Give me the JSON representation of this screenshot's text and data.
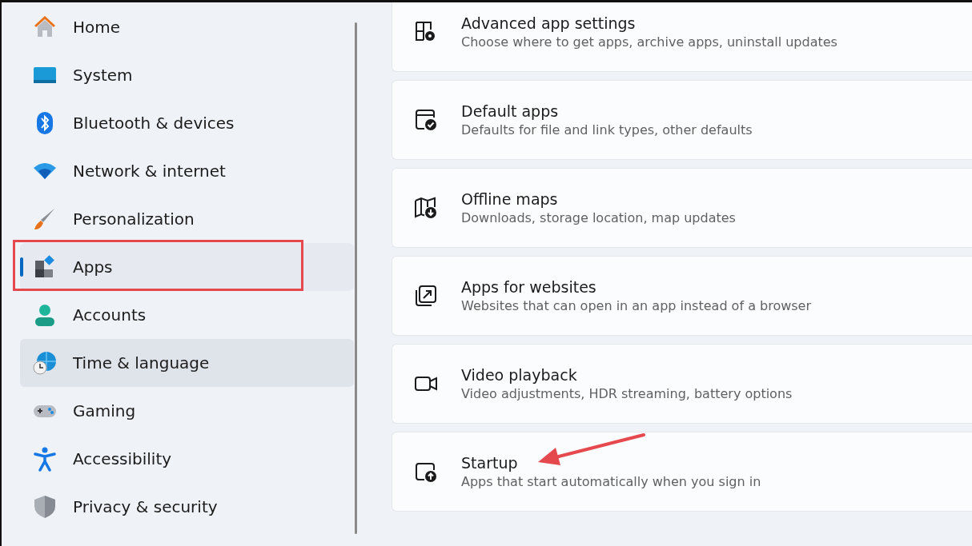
{
  "sidebar": {
    "items": [
      {
        "label": "Home",
        "selected": false,
        "hovered": false,
        "highlighted": false
      },
      {
        "label": "System",
        "selected": false,
        "hovered": false,
        "highlighted": false
      },
      {
        "label": "Bluetooth & devices",
        "selected": false,
        "hovered": false,
        "highlighted": false
      },
      {
        "label": "Network & internet",
        "selected": false,
        "hovered": false,
        "highlighted": false
      },
      {
        "label": "Personalization",
        "selected": false,
        "hovered": false,
        "highlighted": false
      },
      {
        "label": "Apps",
        "selected": true,
        "hovered": false,
        "highlighted": true
      },
      {
        "label": "Accounts",
        "selected": false,
        "hovered": false,
        "highlighted": false
      },
      {
        "label": "Time & language",
        "selected": false,
        "hovered": true,
        "highlighted": false
      },
      {
        "label": "Gaming",
        "selected": false,
        "hovered": false,
        "highlighted": false
      },
      {
        "label": "Accessibility",
        "selected": false,
        "hovered": false,
        "highlighted": false
      },
      {
        "label": "Privacy & security",
        "selected": false,
        "hovered": false,
        "highlighted": false
      }
    ]
  },
  "settings": [
    {
      "title": "Advanced app settings",
      "description": "Choose where to get apps, archive apps, uninstall updates",
      "pointed": false
    },
    {
      "title": "Default apps",
      "description": "Defaults for file and link types, other defaults",
      "pointed": false
    },
    {
      "title": "Offline maps",
      "description": "Downloads, storage location, map updates",
      "pointed": false
    },
    {
      "title": "Apps for websites",
      "description": "Websites that can open in an app instead of a browser",
      "pointed": false
    },
    {
      "title": "Video playback",
      "description": "Video adjustments, HDR streaming, battery options",
      "pointed": false
    },
    {
      "title": "Startup",
      "description": "Apps that start automatically when you sign in",
      "pointed": true
    }
  ]
}
